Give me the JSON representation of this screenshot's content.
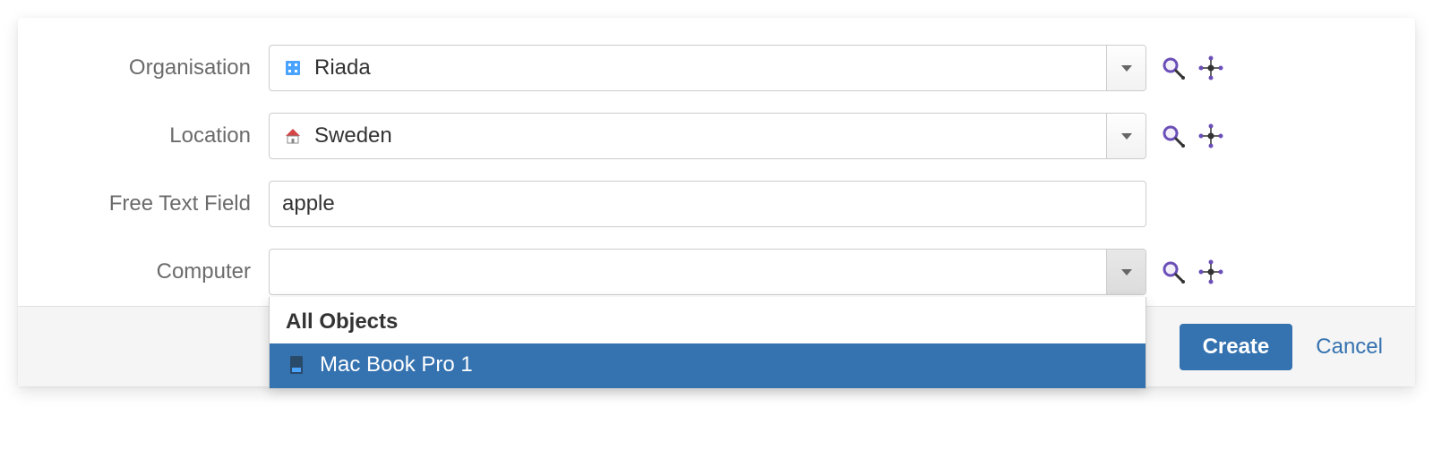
{
  "fields": {
    "organisation": {
      "label": "Organisation",
      "value": "Riada"
    },
    "location": {
      "label": "Location",
      "value": "Sweden"
    },
    "free_text": {
      "label": "Free Text Field",
      "value": "apple"
    },
    "computer": {
      "label": "Computer",
      "value": "",
      "dropdown": {
        "header": "All Objects",
        "option": "Mac Book Pro 1"
      }
    }
  },
  "footer": {
    "create_label": "Create",
    "cancel_label": "Cancel"
  }
}
